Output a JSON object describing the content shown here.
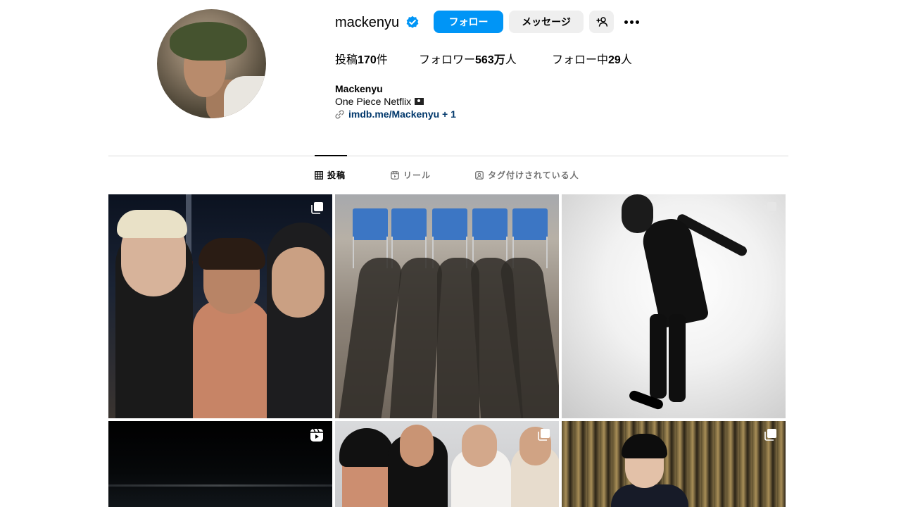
{
  "profile": {
    "username": "mackenyu",
    "full_name": "Mackenyu",
    "bio": "One Piece Netflix",
    "link": "imdb.me/Mackenyu + 1",
    "verified_color": "#0095f6"
  },
  "actions": {
    "follow_label": "フォロー",
    "message_label": "メッセージ",
    "suggest_icon": "person-add-icon",
    "more_icon": "more-options-icon"
  },
  "stats": {
    "posts_prefix": "投稿",
    "posts_count": "170",
    "posts_suffix": "件",
    "followers_prefix": "フォロワー",
    "followers_count": "563万",
    "followers_suffix": "人",
    "following_prefix": "フォロー中",
    "following_count": "29",
    "following_suffix": "人"
  },
  "tabs": [
    {
      "label": "投稿",
      "icon": "grid-icon",
      "active": true
    },
    {
      "label": "リール",
      "icon": "reels-icon",
      "active": false
    },
    {
      "label": "タグ付けされている人",
      "icon": "tagged-icon",
      "active": false
    }
  ],
  "posts": [
    {
      "type": "carousel",
      "badge_icon": "carousel-icon"
    },
    {
      "type": "image",
      "badge_icon": ""
    },
    {
      "type": "carousel",
      "badge_icon": "carousel-icon"
    },
    {
      "type": "reel",
      "badge_icon": "reels-icon"
    },
    {
      "type": "carousel",
      "badge_icon": "carousel-icon"
    },
    {
      "type": "carousel",
      "badge_icon": "carousel-icon"
    }
  ],
  "colors": {
    "accent": "#0095f6",
    "link": "#00376b",
    "secondary_button": "#efefef",
    "muted_text": "#737373",
    "divider": "#dbdbdb"
  }
}
